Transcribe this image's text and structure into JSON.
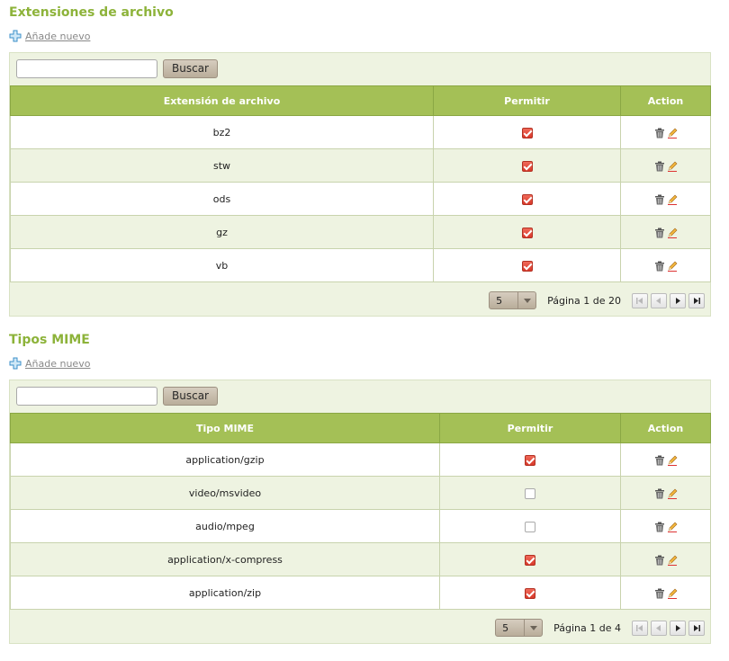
{
  "sections": [
    {
      "title": "Extensiones de archivo",
      "add_label": "Añade nuevo",
      "search_button": "Buscar",
      "search_value": "",
      "columns": [
        "Extensión de archivo",
        "Permitir",
        "Action"
      ],
      "rows": [
        {
          "name": "bz2",
          "allowed": true
        },
        {
          "name": "stw",
          "allowed": true
        },
        {
          "name": "ods",
          "allowed": true
        },
        {
          "name": "gz",
          "allowed": true
        },
        {
          "name": "vb",
          "allowed": true
        }
      ],
      "page_size": "5",
      "page_info": "Página 1 de 20"
    },
    {
      "title": "Tipos MIME",
      "add_label": "Añade nuevo",
      "search_button": "Buscar",
      "search_value": "",
      "columns": [
        "Tipo MIME",
        "Permitir",
        "Action"
      ],
      "rows": [
        {
          "name": "application/gzip",
          "allowed": true
        },
        {
          "name": "video/msvideo",
          "allowed": false
        },
        {
          "name": "audio/mpeg",
          "allowed": false
        },
        {
          "name": "application/x-compress",
          "allowed": true
        },
        {
          "name": "application/zip",
          "allowed": true
        }
      ],
      "page_size": "5",
      "page_info": "Página 1 de 4"
    }
  ],
  "icons": {
    "add": "plus-icon",
    "delete": "trash-icon",
    "edit": "pencil-icon",
    "first": "first-page-icon",
    "prev": "prev-page-icon",
    "next": "next-page-icon",
    "last": "last-page-icon",
    "dropdown": "chevron-down-icon"
  },
  "colors": {
    "title": "#8db33a",
    "header": "#a4c056",
    "panel": "#eef3e1",
    "checked": "#d8392a"
  }
}
